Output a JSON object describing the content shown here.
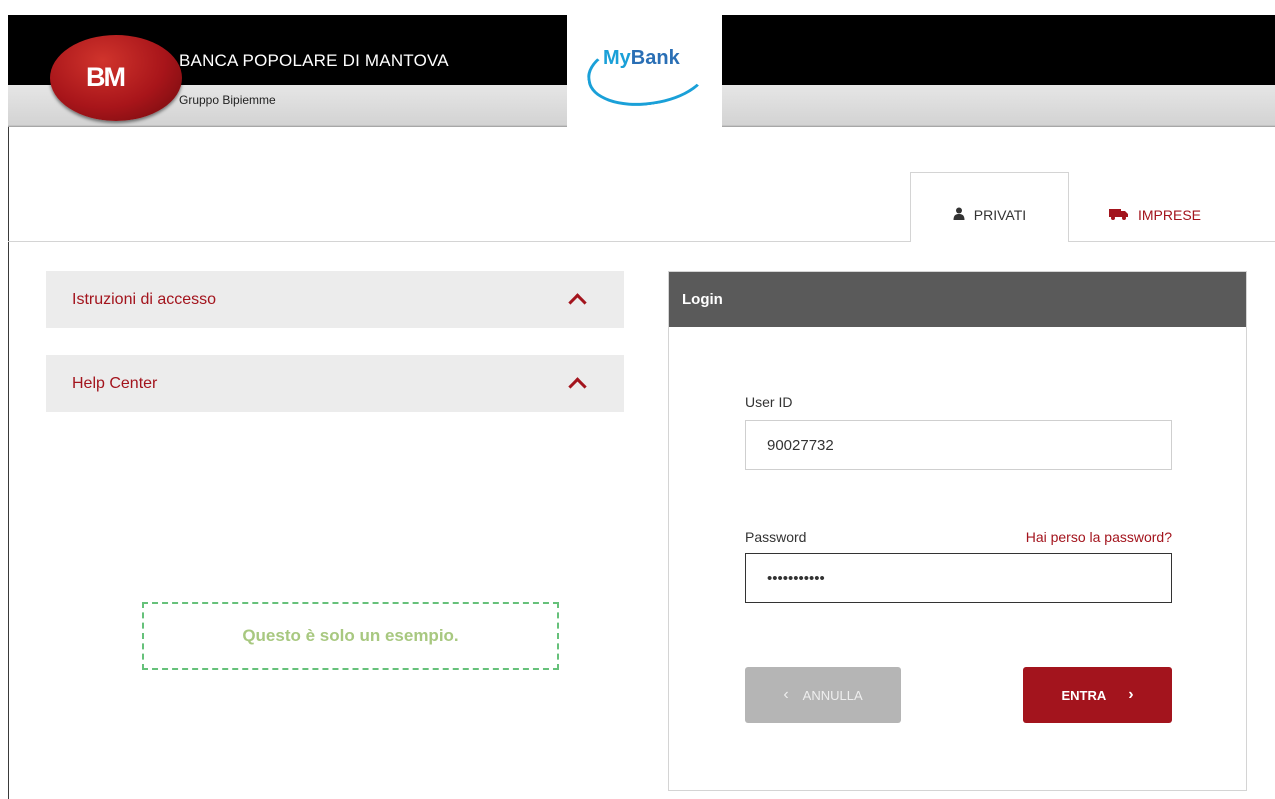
{
  "header": {
    "logo_text": "BM",
    "bank_name": "BANCA POPOLARE DI MANTOVA",
    "group": "Gruppo Bipiemme",
    "mybank": {
      "my": "My",
      "bank": "Bank"
    }
  },
  "tabs": [
    {
      "label": "PRIVATI",
      "icon": "user-icon",
      "active": true
    },
    {
      "label": "IMPRESE",
      "icon": "truck-icon",
      "active": false
    }
  ],
  "accordions": [
    {
      "label": "Istruzioni di accesso",
      "icon": "chevron-up-icon"
    },
    {
      "label": "Help Center",
      "icon": "chevron-up-icon"
    }
  ],
  "example_note": "Questo è solo un esempio.",
  "login": {
    "title": "Login",
    "user_label": "User ID",
    "user_value": "90027732",
    "password_label": "Password",
    "password_value": "•••••••••••",
    "forgot_link": "Hai perso la password?",
    "cancel_label": "ANNULLA",
    "enter_label": "ENTRA"
  },
  "colors": {
    "accent": "#a3141d",
    "header_bg": "#000000",
    "panel_head": "#5a5a5a",
    "accordion_bg": "#ececec",
    "example_border": "#66c17a",
    "example_text": "#a8c880"
  }
}
